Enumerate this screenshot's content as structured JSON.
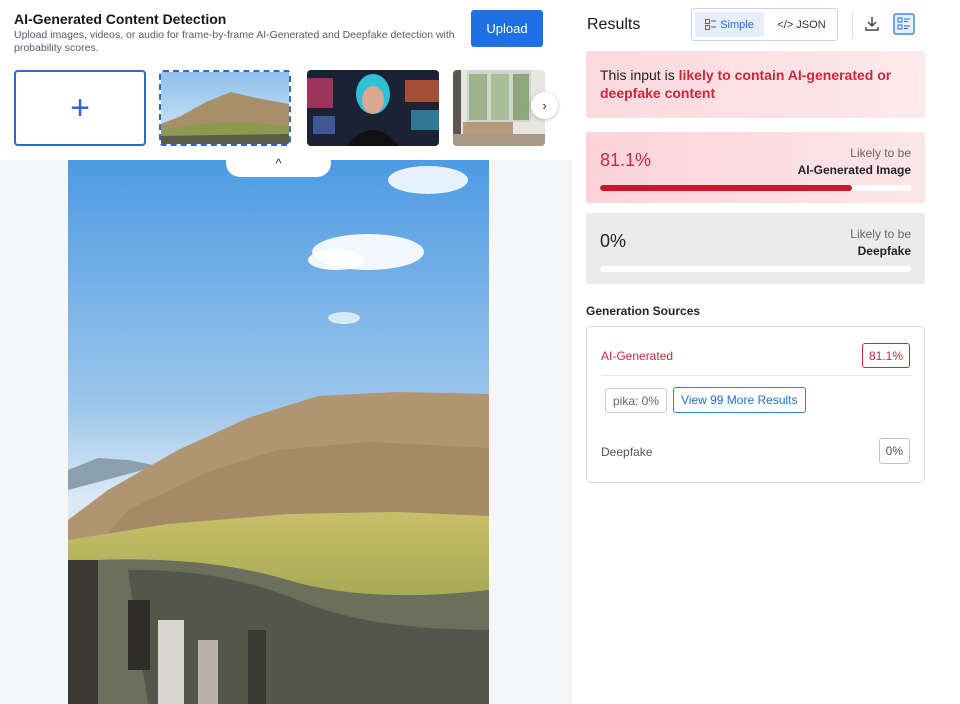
{
  "header": {
    "title": "AI-Generated Content Detection",
    "subtitle": "Upload images, videos, or audio for frame-by-frame AI-Generated and Deepfake detection with probability scores.",
    "upload_label": "Upload"
  },
  "thumbnails": {
    "add_symbol": "+",
    "next_symbol": "›",
    "collapse_symbol": "^"
  },
  "results": {
    "title": "Results",
    "view_toggle": {
      "simple_label": "Simple",
      "json_label": "</> JSON",
      "active": "Simple"
    },
    "alert": {
      "prefix": "This input is ",
      "highlight": "likely to contain AI-generated or deepfake content"
    },
    "scores": [
      {
        "value": "81.1%",
        "fraction": 0.811,
        "caption_top": "Likely to be",
        "caption_bottom": "AI-Generated Image",
        "color": "#c9182b"
      },
      {
        "value": "0%",
        "fraction": 0,
        "caption_top": "Likely to be",
        "caption_bottom": "Deepfake",
        "color": "#9aa0a6"
      }
    ]
  },
  "generation_sources": {
    "title": "Generation Sources",
    "ai": {
      "label": "AI-Generated",
      "value": "81.1%"
    },
    "sub_results": [
      {
        "label": "pika: 0%"
      }
    ],
    "more_button_label": "View 99 More Results",
    "deepfake": {
      "label": "Deepfake",
      "value": "0%"
    }
  },
  "colors": {
    "accent": "#1f6fe5",
    "danger": "#d1263a"
  }
}
